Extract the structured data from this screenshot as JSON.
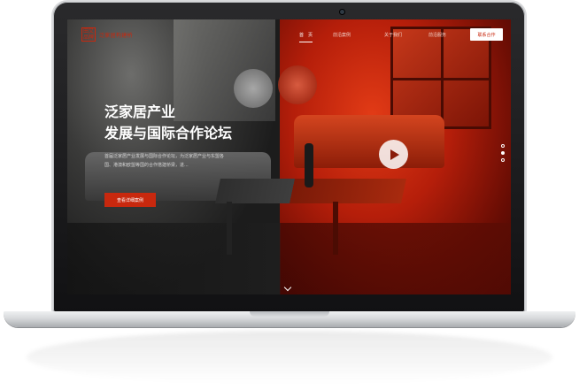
{
  "site": {
    "logo_mark": "田又 品牌",
    "logo_text": "泛家居构建桥"
  },
  "nav": {
    "items": [
      "首　页",
      "前沿案例",
      "关于我们",
      "前沿服务"
    ],
    "contact_button": "联系合作"
  },
  "hero": {
    "title_line1": "泛家居产业",
    "title_line2": "发展与国际合作论坛",
    "description": "首届泛家居产业发展与国际合作论坛，为泛家居产业与东盟各国、港澳和欧盟等国的合作搭建桥梁，进...",
    "cta_label": "查看详细案例"
  },
  "carousel": {
    "slides": 3,
    "active_index": 1
  },
  "colors": {
    "accent": "#c8280e",
    "overlay_red": "#d3341a",
    "text_light": "#ffffff"
  },
  "icons": {
    "play": "play-icon",
    "scroll": "chevron-down-icon"
  }
}
